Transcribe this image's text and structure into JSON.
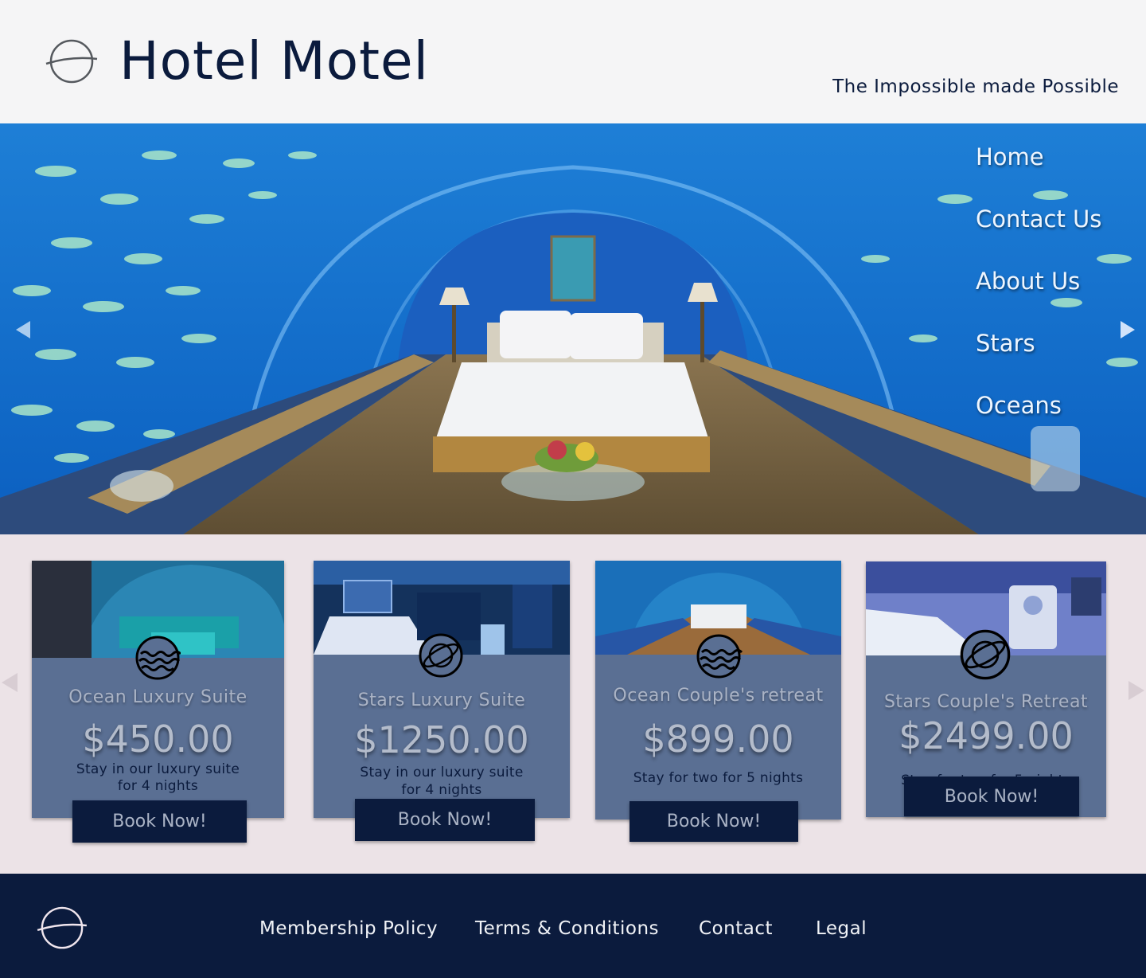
{
  "header": {
    "brand": "Hotel Motel",
    "tagline": "The Impossible made Possible",
    "logo_icon": "orbit-logo-icon"
  },
  "nav": {
    "items": [
      {
        "label": "Home"
      },
      {
        "label": "Contact Us"
      },
      {
        "label": "About Us"
      },
      {
        "label": "Stars"
      },
      {
        "label": "Oceans"
      }
    ]
  },
  "hero": {
    "prev_icon": "chevron-left-icon",
    "next_icon": "chevron-right-icon"
  },
  "cards": [
    {
      "title": "Ocean Luxury Suite",
      "price": "$450.00",
      "desc_line1": "Stay in our luxury suite",
      "desc_line2": "for 4 nights",
      "button": "Book Now!",
      "icon": "waves-icon"
    },
    {
      "title": "Stars Luxury Suite",
      "price": "$1250.00",
      "desc_line1": "Stay in our luxury suite",
      "desc_line2": "for 4 nights",
      "button": "Book Now!",
      "icon": "planet-icon"
    },
    {
      "title": "Ocean Couple's retreat",
      "price": "$899.00",
      "desc_line1": "Stay for two for 5 nights",
      "desc_line2": "",
      "button": "Book Now!",
      "icon": "waves-icon"
    },
    {
      "title": "Stars Couple's Retreat",
      "price": "$2499.00",
      "desc_line1": "Stay for two for 5 nights",
      "desc_line2": "",
      "button": "Book Now!",
      "icon": "planet-icon"
    }
  ],
  "footer": {
    "links": [
      {
        "label": "Membership Policy"
      },
      {
        "label": "Terms & Conditions"
      },
      {
        "label": "Contact"
      },
      {
        "label": "Legal"
      }
    ]
  },
  "colors": {
    "navy": "#0b1b3d",
    "card_bg": "#5a6f93",
    "section_bg": "#ece3e7",
    "header_bg": "#f5f5f6"
  }
}
